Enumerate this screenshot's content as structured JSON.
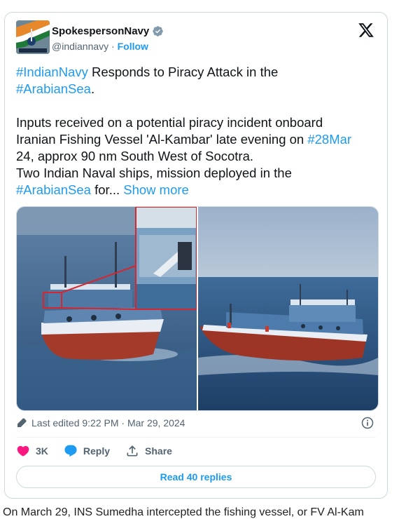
{
  "author": {
    "name": "SpokespersonNavy",
    "handle": "@indiannavy",
    "separator": "·",
    "follow_label": "Follow"
  },
  "tweet": {
    "line1_tag": "#IndianNavy",
    "line1_text": " Responds to Piracy Attack in the",
    "line2_tag": "#ArabianSea",
    "line2_text": ".",
    "p2_a": "Inputs received on a potential piracy incident onboard",
    "p2_b": "Iranian Fishing Vessel 'Al-Kambar' late evening on ",
    "p2_b_tag": "#28Mar",
    "p2_c": "24, approx 90 nm South West of Socotra.",
    "p2_d": "Two Indian Naval ships, mission deployed in the",
    "p2_e_tag": "#ArabianSea",
    "p2_e_text": " for... ",
    "show_more": "Show more"
  },
  "meta": {
    "edited": "Last edited 9:22 PM · Mar 29, 2024"
  },
  "actions": {
    "like_count": "3K",
    "reply_label": "Reply",
    "share_label": "Share",
    "read_replies": "Read 40 replies"
  },
  "below_text": "On March 29, INS Sumedha intercepted the fishing vessel, or FV Al-Kam",
  "colors": {
    "link": "#1d9bf0",
    "like": "#f91880",
    "border": "#cfd9de"
  }
}
